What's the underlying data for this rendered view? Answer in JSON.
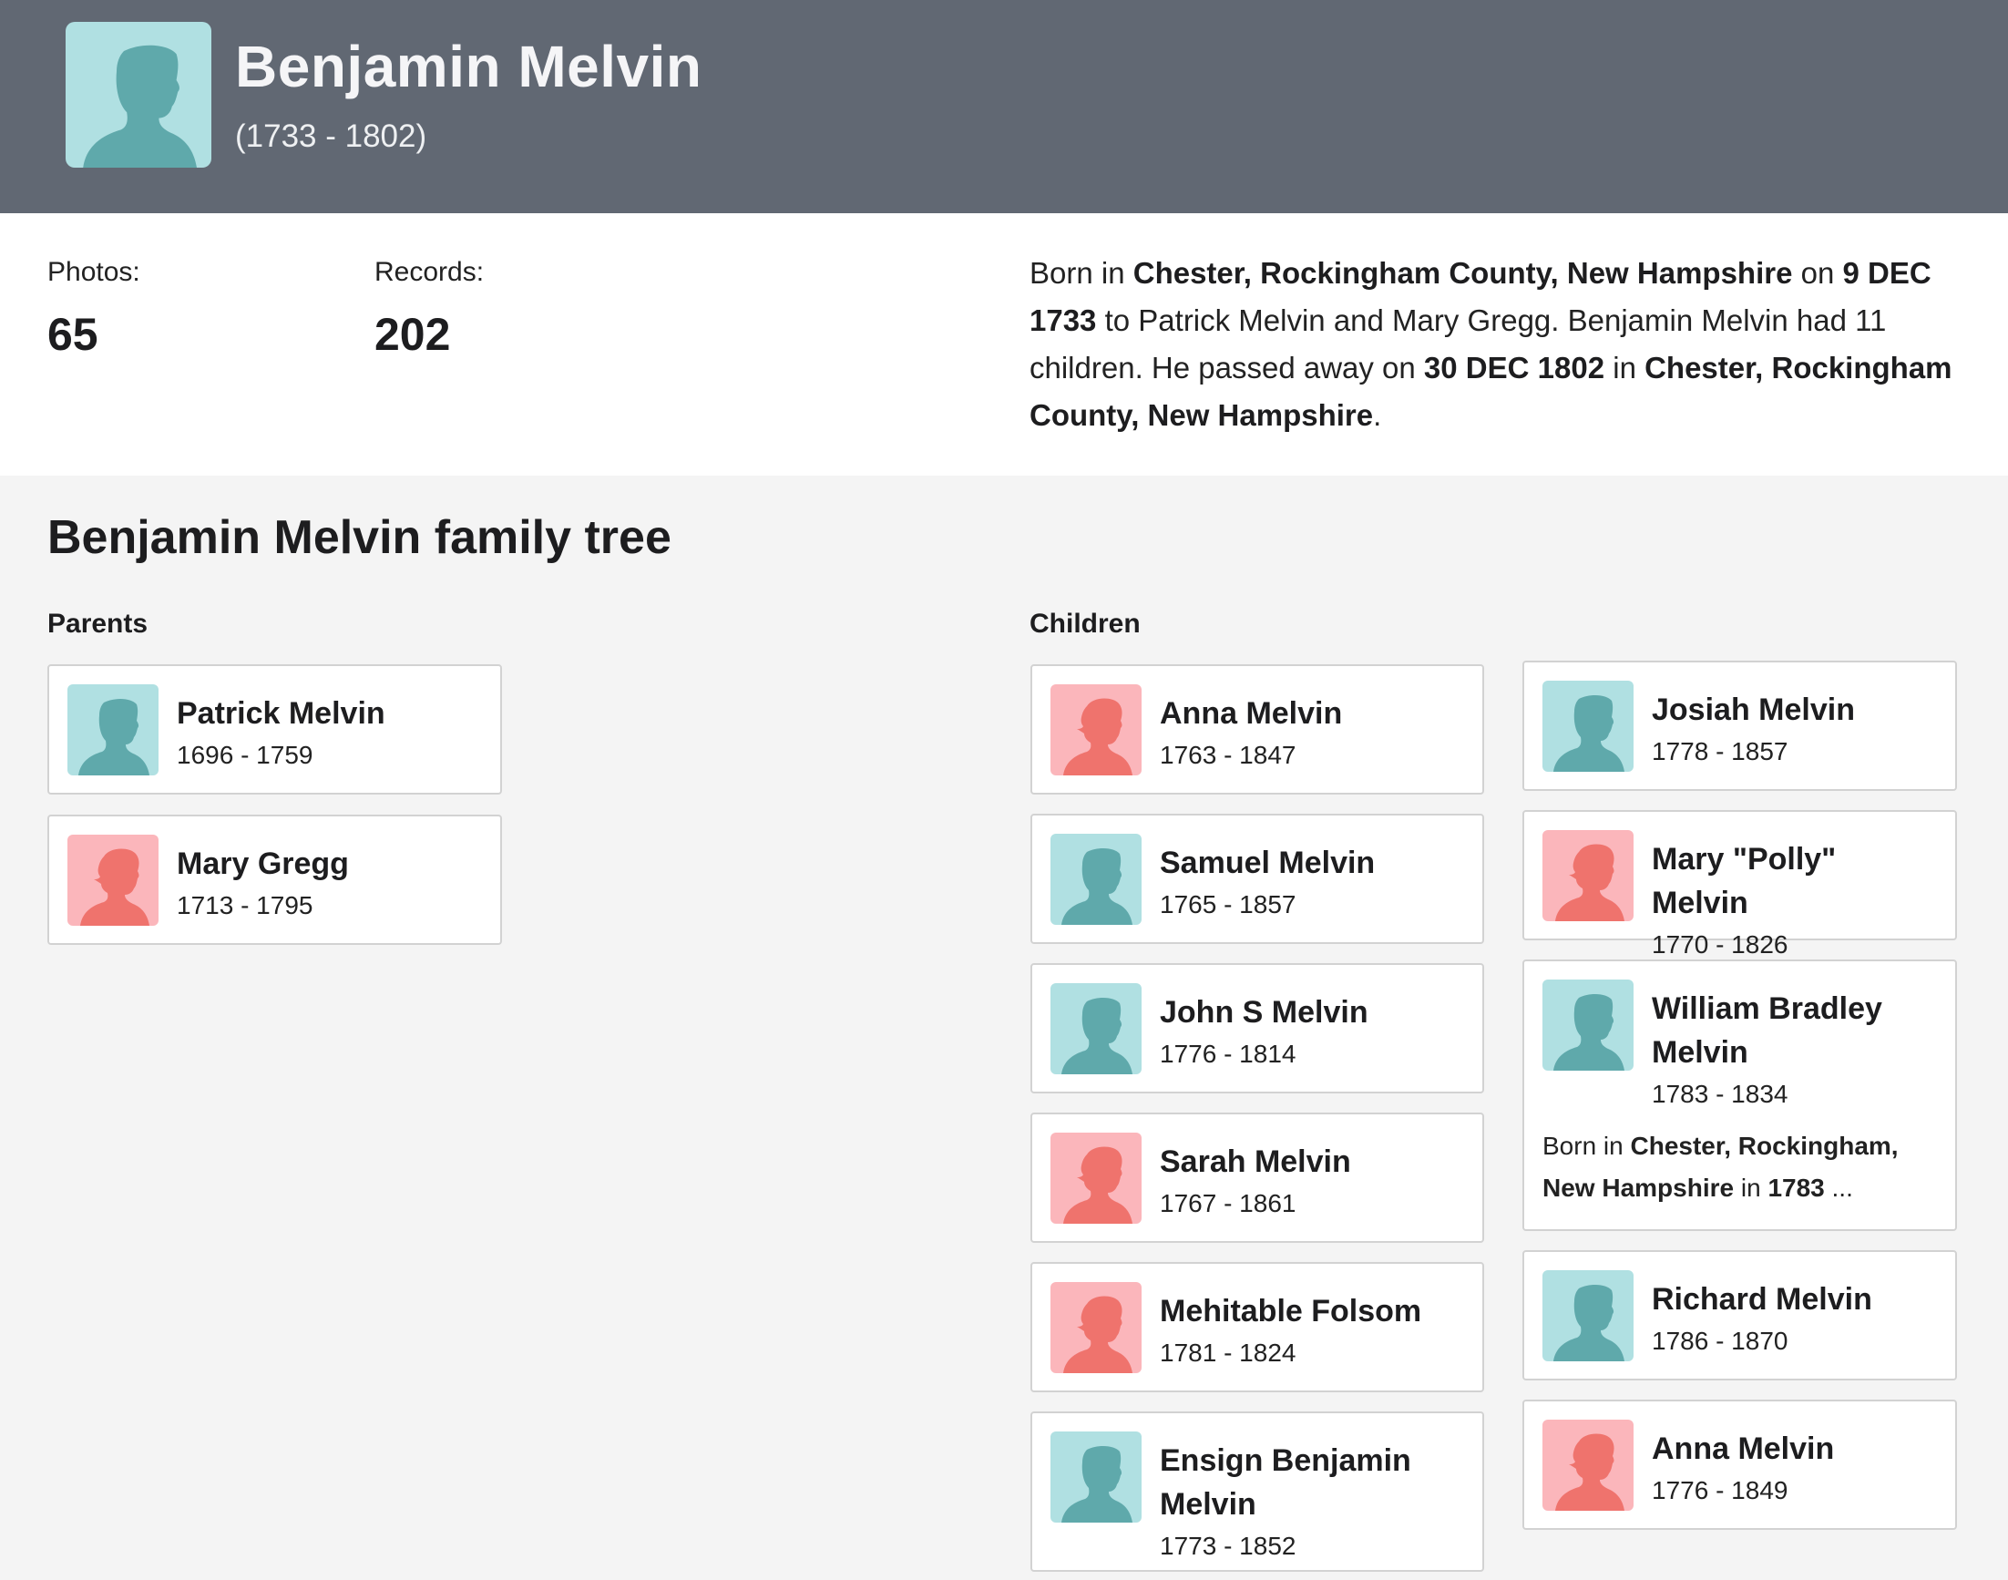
{
  "colors": {
    "header_bg": "#616873",
    "male_bg": "#b0e0e2",
    "male_fg": "#5fa9ab",
    "female_bg": "#fbb6bb",
    "female_fg": "#ef736d",
    "page_bg": "#f4f4f4"
  },
  "profile": {
    "name": "Benjamin Melvin",
    "dates": "(1733 - 1802)",
    "avatar_icon": "male-silhouette-icon",
    "gender": "male"
  },
  "stats": {
    "photos_label": "Photos:",
    "photos_value": "65",
    "records_label": "Records:",
    "records_value": "202"
  },
  "bio": {
    "segments": [
      {
        "text": "Born in ",
        "bold": false
      },
      {
        "text": "Chester, Rockingham County, New Hampshire",
        "bold": true
      },
      {
        "text": " on ",
        "bold": false
      },
      {
        "text": "9 DEC 1733",
        "bold": true
      },
      {
        "text": " to Patrick Melvin and Mary Gregg. Benjamin Melvin had 11 children. He passed away on ",
        "bold": false
      },
      {
        "text": "30 DEC 1802",
        "bold": true
      },
      {
        "text": " in ",
        "bold": false
      },
      {
        "text": "Chester, Rockingham County, New Hampshire",
        "bold": true
      },
      {
        "text": ".",
        "bold": false
      }
    ]
  },
  "tree": {
    "title": "Benjamin Melvin family tree",
    "parents_label": "Parents",
    "children_label": "Children",
    "parents": [
      {
        "name": "Patrick Melvin",
        "dates": "1696 - 1759",
        "gender": "male"
      },
      {
        "name": "Mary Gregg",
        "dates": "1713 - 1795",
        "gender": "female"
      }
    ],
    "children_col1": [
      {
        "name": "Anna Melvin",
        "dates": "1763 - 1847",
        "gender": "female"
      },
      {
        "name": "Samuel Melvin",
        "dates": "1765 - 1857",
        "gender": "male"
      },
      {
        "name": "John S Melvin",
        "dates": "1776 - 1814",
        "gender": "male"
      },
      {
        "name": "Sarah Melvin",
        "dates": "1767 - 1861",
        "gender": "female"
      },
      {
        "name": "Mehitable Folsom",
        "dates": "1781 - 1824",
        "gender": "female"
      },
      {
        "name": "Ensign Benjamin Melvin",
        "dates": "1773 - 1852",
        "gender": "male"
      }
    ],
    "children_col2": [
      {
        "name": "Josiah Melvin",
        "dates": "1778 - 1857",
        "gender": "male"
      },
      {
        "name": "Mary \"Polly\" Melvin",
        "dates": "1770 - 1826",
        "gender": "female"
      },
      {
        "name": "William Bradley Melvin",
        "dates": "1783 - 1834",
        "gender": "male",
        "snippet": [
          {
            "text": "Born in ",
            "bold": false
          },
          {
            "text": "Chester, Rockingham, New Hampshire",
            "bold": true
          },
          {
            "text": " in ",
            "bold": false
          },
          {
            "text": "1783",
            "bold": true
          },
          {
            "text": " ...",
            "bold": false
          }
        ]
      },
      {
        "name": "Richard Melvin",
        "dates": "1786 - 1870",
        "gender": "male"
      },
      {
        "name": "Anna Melvin",
        "dates": "1776 - 1849",
        "gender": "female"
      }
    ]
  }
}
